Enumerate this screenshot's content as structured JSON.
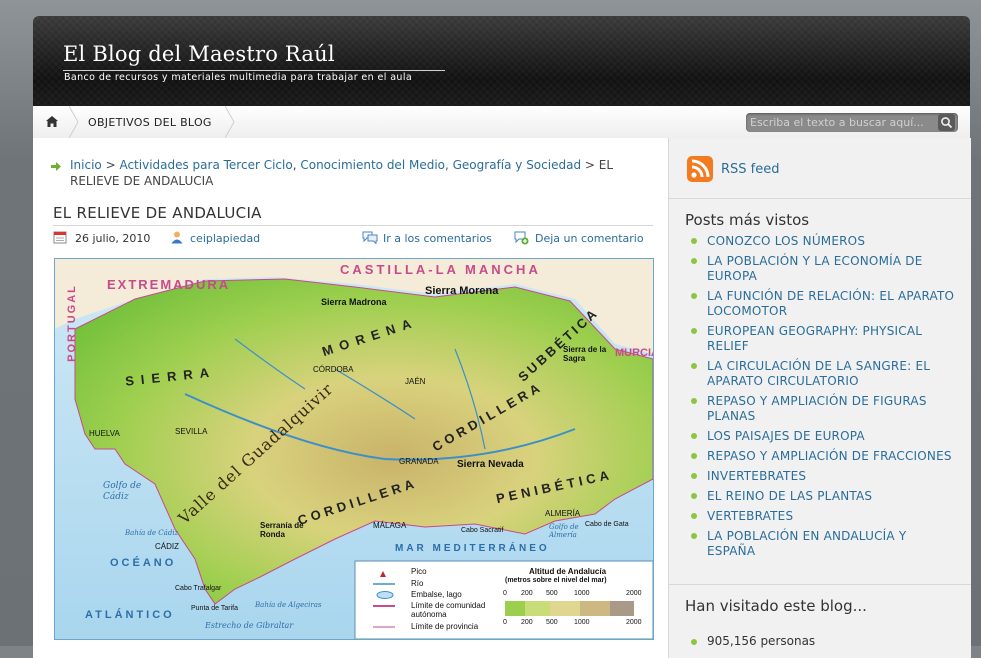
{
  "site": {
    "title": "El Blog del Maestro Raúl",
    "description": "Banco de recursos y materiales multimedia para trabajar en el aula"
  },
  "nav": {
    "home_icon": "home-icon",
    "items": [
      "OBJETIVOS DEL BLOG"
    ],
    "search_placeholder": "Escriba el texto a buscar aquí..."
  },
  "breadcrumb": {
    "home": "Inicio",
    "sep1": " > ",
    "category": "Actividades para Tercer Ciclo",
    "comma": ", ",
    "category2": "Conocimiento del Medio, Geografía y Sociedad",
    "sep2": " > ",
    "current": "EL RELIEVE DE ANDALUCIA"
  },
  "post": {
    "title": "EL RELIEVE DE ANDALUCIA",
    "date": "26 julio, 2010",
    "author": "ceiplapiedad",
    "comments_link": "Ir a los comentarios",
    "leave_comment": "Deja un comentario"
  },
  "map": {
    "regions": [
      "CASTILLA-LA MANCHA",
      "EXTREMADURA",
      "PORTUGAL",
      "MURCIA"
    ],
    "ranges": [
      "SIERRA",
      "MORENA",
      "SUBBÉTICA",
      "CORDILLERA",
      "CORDILLERA",
      "PENIBÉTICA",
      "Valle del Guadalquivir",
      "Sierra Morena",
      "Sierra Madrona",
      "Sierra Nevada"
    ],
    "cities": [
      "CÓRDOBA",
      "JAÉN",
      "SEVILLA",
      "HUELVA",
      "GRANADA",
      "MÁLAGA",
      "CÁDIZ",
      "ALMERÍA"
    ],
    "seas": [
      "MAR MEDITERRÁNEO",
      "OCÉANO",
      "ATLÁNTICO"
    ],
    "places": [
      "Golfo de Cádiz",
      "Bahía de Cádiz",
      "Cabo Trafalgar",
      "Punta de Tarifa",
      "Bahía de Algeciras",
      "Estrecho de Gibraltar",
      "Cabo Sacratif",
      "Golfo de Almería",
      "Cabo de Gata",
      "Sierra de la Sagra",
      "Serranía de Ronda"
    ],
    "legend": {
      "items": [
        "Pico",
        "Río",
        "Embalse, lago",
        "Límite de comunidad autónoma",
        "Límite de provincia"
      ],
      "altitude_title": "Altitud de Andalucía",
      "altitude_subtitle": "(metros sobre el nivel del mar)",
      "ticks": [
        "0",
        "200",
        "500",
        "1000",
        "2000"
      ]
    }
  },
  "sidebar": {
    "rss_icon": "rss-icon",
    "rss_label": "RSS feed",
    "popular_title": "Posts más vistos",
    "popular": [
      "CONOZCO LOS NÚMEROS",
      "LA POBLACIÓN Y LA ECONOMÍA DE EUROPA",
      "LA FUNCIÓN DE RELACIÓN: EL APARATO LOCOMOTOR",
      "EUROPEAN GEOGRAPHY: PHYSICAL RELIEF",
      "LA CIRCULACIÓN DE LA SANGRE: EL APARATO CIRCULATORIO",
      "REPASO Y AMPLIACIÓN DE FIGURAS PLANAS",
      "LOS PAISAJES DE EUROPA",
      "REPASO Y AMPLIACIÓN DE FRACCIONES",
      "INVERTEBRATES",
      "EL REINO DE LAS PLANTAS",
      "VERTEBRATES",
      "LA POBLACIÓN EN ANDALUCÍA Y ESPAÑA"
    ],
    "visitors_title": "Han visitado este blog...",
    "visitors_count": "905,156 personas"
  }
}
